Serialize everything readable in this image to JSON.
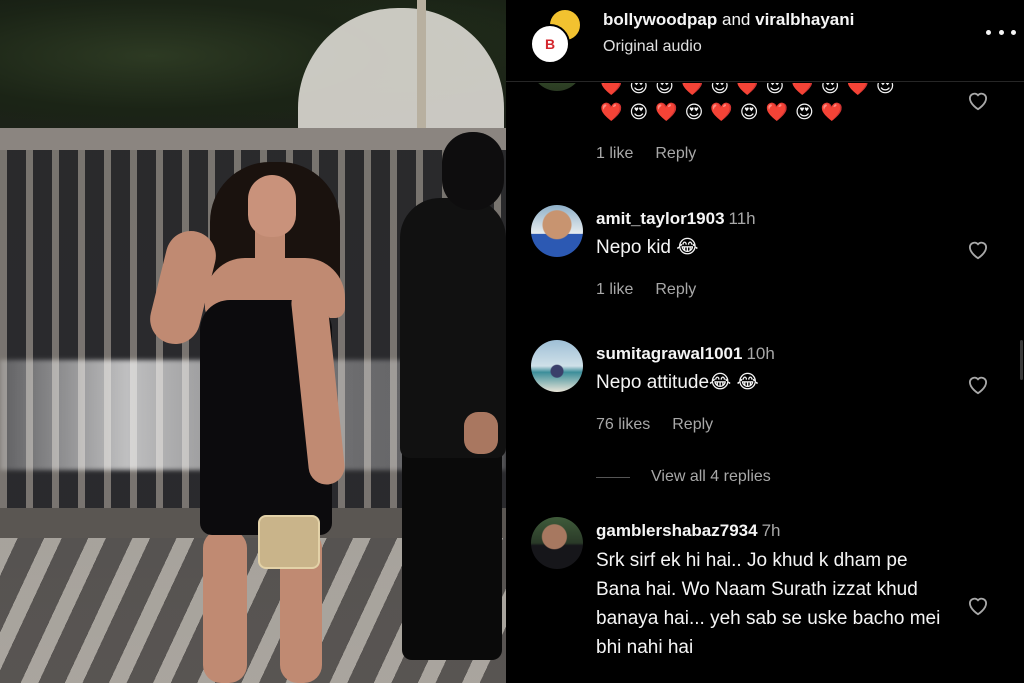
{
  "header": {
    "user1": "bollywoodpap",
    "and": "and",
    "user2": "viralbhayani",
    "subtitle": "Original audio",
    "more_icon": "more-horizontal-icon"
  },
  "comments": [
    {
      "username": "",
      "text": "❤️😍😍❤️😍❤️😍❤️😍❤️😍",
      "text2": "❤️😍❤️😍❤️😍❤️😍❤️",
      "likes": "1 like",
      "reply": "Reply"
    },
    {
      "username": "amit_taylor1903",
      "time": "11h",
      "text": "Nepo kid 😂",
      "likes": "1 like",
      "reply": "Reply"
    },
    {
      "username": "sumitagrawal1001",
      "time": "10h",
      "text": "Nepo attitude😂 😂",
      "likes": "76 likes",
      "reply": "Reply",
      "view_replies": "View all 4 replies"
    },
    {
      "username": "gamblershabaz7934",
      "time": "7h",
      "text": "Srk sirf ek hi hai.. Jo khud k dham pe Bana hai. Wo Naam Surath izzat khud banaya hai... yeh sab se uske bacho mei bhi nahi hai"
    }
  ],
  "colors": {
    "panel_bg": "#000000",
    "text_primary": "#f5f5f5",
    "text_secondary": "#a8a8a8"
  }
}
